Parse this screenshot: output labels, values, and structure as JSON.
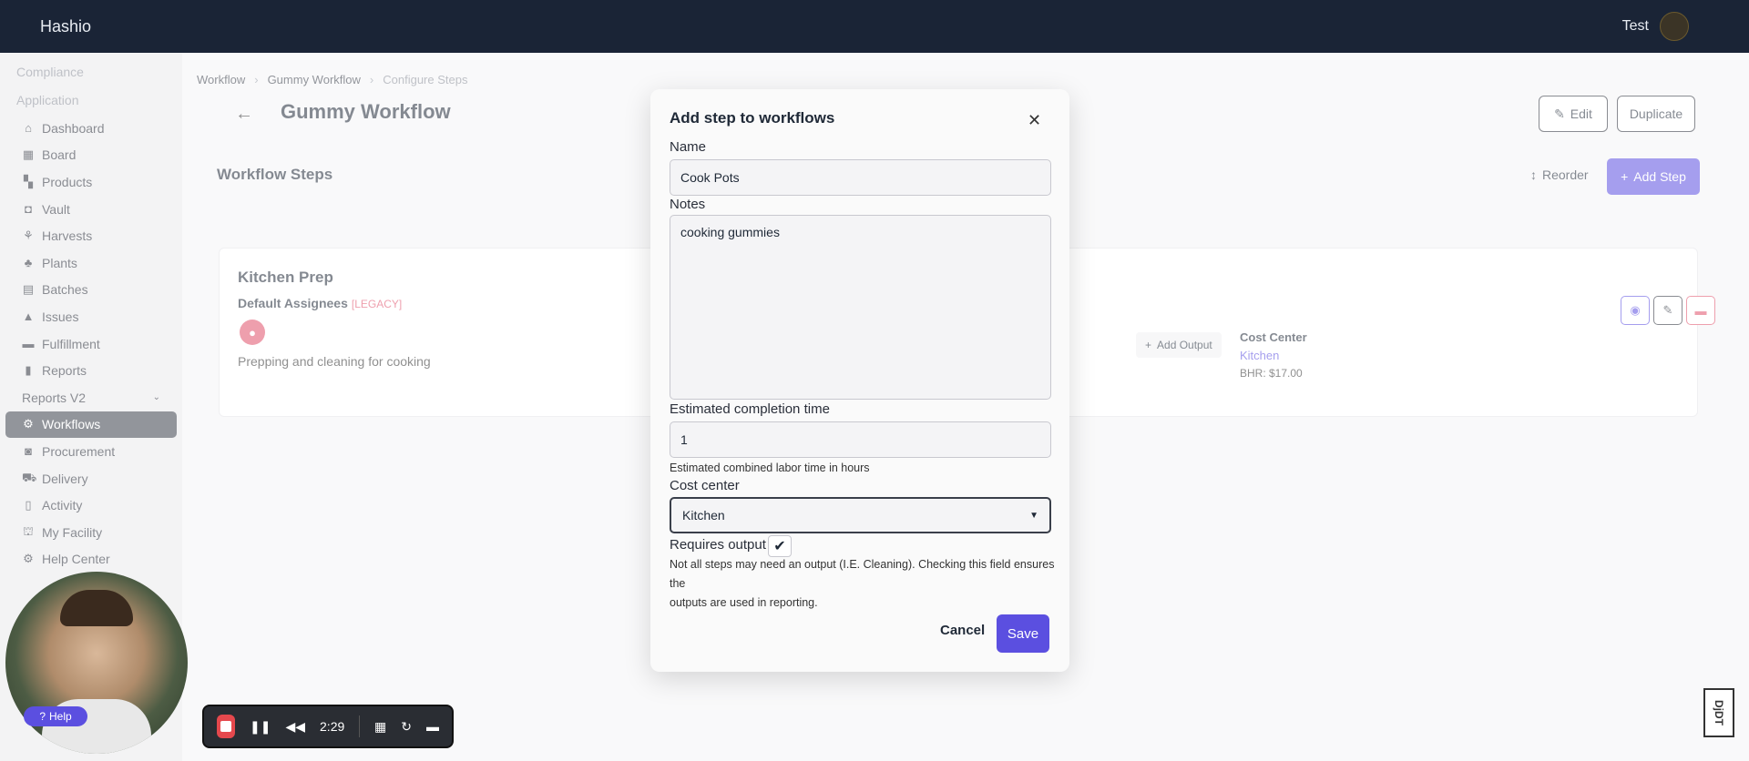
{
  "topbar": {
    "brand": "Hashio",
    "user": "Test"
  },
  "sidebar": {
    "sections": [
      "Compliance",
      "Application"
    ],
    "items": [
      {
        "label": "Dashboard",
        "icon": "home-icon",
        "glyph": "⌂"
      },
      {
        "label": "Board",
        "icon": "board-icon",
        "glyph": "▦"
      },
      {
        "label": "Products",
        "icon": "products-icon",
        "glyph": "▚"
      },
      {
        "label": "Vault",
        "icon": "vault-icon",
        "glyph": "◘"
      },
      {
        "label": "Harvests",
        "icon": "harvest-icon",
        "glyph": "⚘"
      },
      {
        "label": "Plants",
        "icon": "plant-icon",
        "glyph": "♣"
      },
      {
        "label": "Batches",
        "icon": "batches-icon",
        "glyph": "▤"
      },
      {
        "label": "Issues",
        "icon": "warning-icon",
        "glyph": "▲"
      },
      {
        "label": "Fulfillment",
        "icon": "fulfillment-icon",
        "glyph": "▬"
      },
      {
        "label": "Reports",
        "icon": "chart-icon",
        "glyph": "▮"
      },
      {
        "label": "Reports V2",
        "icon": "chevron-down-icon",
        "glyph": "⌄"
      },
      {
        "label": "Workflows",
        "icon": "workflow-icon",
        "glyph": "⚙"
      },
      {
        "label": "Procurement",
        "icon": "procurement-icon",
        "glyph": "◙"
      },
      {
        "label": "Delivery",
        "icon": "truck-icon",
        "glyph": "⛟"
      },
      {
        "label": "Activity",
        "icon": "activity-icon",
        "glyph": "▯"
      },
      {
        "label": "My Facility",
        "icon": "facility-icon",
        "glyph": "⛫"
      },
      {
        "label": "Help Center",
        "icon": "help-icon",
        "glyph": "⚙"
      }
    ]
  },
  "breadcrumb": [
    "Workflow",
    "Gummy Workflow",
    "Configure Steps"
  ],
  "page": {
    "title": "Gummy Workflow",
    "edit_label": "Edit",
    "duplicate_label": "Duplicate",
    "section_title": "Workflow Steps",
    "reorder_label": "Reorder",
    "add_step_label": "Add Step"
  },
  "step_card": {
    "title": "Kitchen Prep",
    "assignees_label": "Default Assignees",
    "legacy_tag": "[LEGACY]",
    "description": "Prepping and cleaning for cooking",
    "add_output_label": "Add Output",
    "cost_center_label": "Cost Center",
    "cost_center_value": "Kitchen",
    "bhr": "BHR: $17.00"
  },
  "modal": {
    "title": "Add step to workflows",
    "name_label": "Name",
    "name_value": "Cook Pots",
    "notes_label": "Notes",
    "notes_value": "cooking gummies",
    "ect_label": "Estimated completion time",
    "ect_value": "1",
    "ect_hint": "Estimated combined labor time in hours",
    "cost_center_label": "Cost center",
    "cost_center_value": "Kitchen",
    "requires_output_label": "Requires output",
    "requires_output_checked": true,
    "requires_output_hint_1": "Not all steps may need an output (I.E. Cleaning). Checking this field ensures the",
    "requires_output_hint_2": "outputs are used in reporting.",
    "cancel_label": "Cancel",
    "save_label": "Save"
  },
  "recorder": {
    "help_label": "Help",
    "time": "2:29"
  },
  "colors": {
    "accent": "#5b4fe0",
    "topbar": "#1a2436",
    "danger": "#e0506a"
  }
}
